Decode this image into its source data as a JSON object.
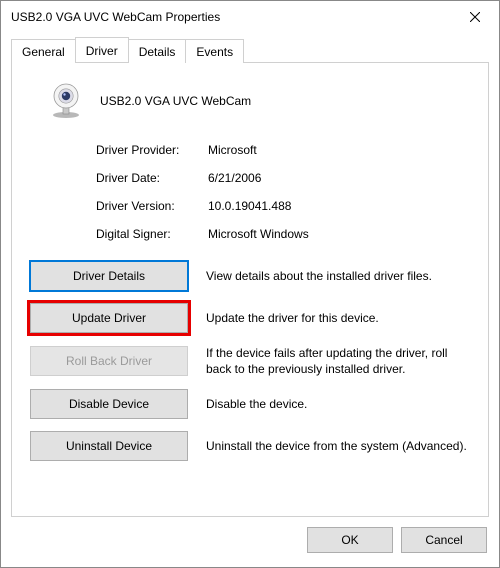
{
  "window": {
    "title": "USB2.0 VGA UVC WebCam Properties"
  },
  "tabs": {
    "general": "General",
    "driver": "Driver",
    "details": "Details",
    "events": "Events"
  },
  "device": {
    "name": "USB2.0 VGA UVC WebCam"
  },
  "props": {
    "provider_label": "Driver Provider:",
    "provider_value": "Microsoft",
    "date_label": "Driver Date:",
    "date_value": "6/21/2006",
    "version_label": "Driver Version:",
    "version_value": "10.0.19041.488",
    "signer_label": "Digital Signer:",
    "signer_value": "Microsoft Windows"
  },
  "actions": {
    "details_btn": "Driver Details",
    "details_desc": "View details about the installed driver files.",
    "update_btn": "Update Driver",
    "update_desc": "Update the driver for this device.",
    "rollback_btn": "Roll Back Driver",
    "rollback_desc": "If the device fails after updating the driver, roll back to the previously installed driver.",
    "disable_btn": "Disable Device",
    "disable_desc": "Disable the device.",
    "uninstall_btn": "Uninstall Device",
    "uninstall_desc": "Uninstall the device from the system (Advanced)."
  },
  "dialog": {
    "ok": "OK",
    "cancel": "Cancel"
  }
}
